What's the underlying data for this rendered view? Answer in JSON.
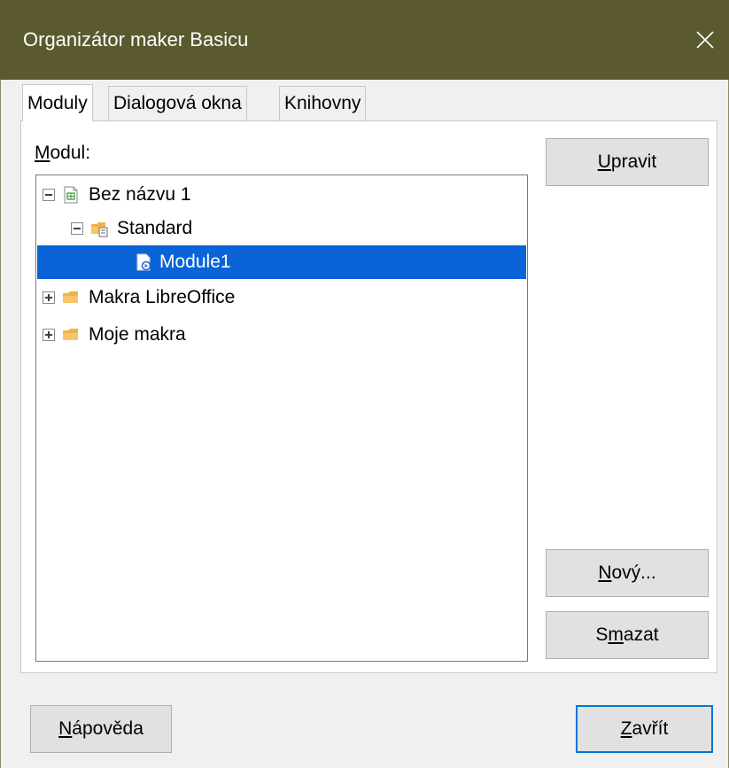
{
  "window": {
    "title": "Organizátor maker Basicu",
    "close_icon": "close-icon"
  },
  "tabs": [
    {
      "label": "Moduly",
      "active": true
    },
    {
      "label": "Dialogová okna",
      "active": false
    },
    {
      "label": "Knihovny",
      "active": false
    }
  ],
  "module_label": {
    "mnemonic": "M",
    "rest": "odul:"
  },
  "tree": [
    {
      "label": "Bez názvu 1",
      "level": 0,
      "expanded": true,
      "icon": "spreadsheet-document-icon"
    },
    {
      "label": "Standard",
      "level": 1,
      "expanded": true,
      "icon": "library-folder-icon"
    },
    {
      "label": "Module1",
      "level": 2,
      "selected": true,
      "icon": "basic-module-icon"
    },
    {
      "label": "Makra LibreOffice",
      "level": 0,
      "expanded": false,
      "icon": "folder-icon"
    },
    {
      "label": "Moje makra",
      "level": 0,
      "expanded": false,
      "icon": "folder-icon"
    }
  ],
  "buttons": {
    "edit": {
      "mnemonic": "U",
      "rest": "pravit"
    },
    "new": {
      "mnemonic": "N",
      "rest": "ový..."
    },
    "delete": {
      "pre": "S",
      "mnemonic": "m",
      "rest": "azat"
    },
    "help": {
      "mnemonic": "N",
      "rest": "ápověda"
    },
    "close": {
      "mnemonic": "Z",
      "rest": "avřít"
    }
  },
  "colors": {
    "titlebar": "#5a5a2e",
    "selection": "#0b64d7",
    "default_button_border": "#0078d7"
  }
}
